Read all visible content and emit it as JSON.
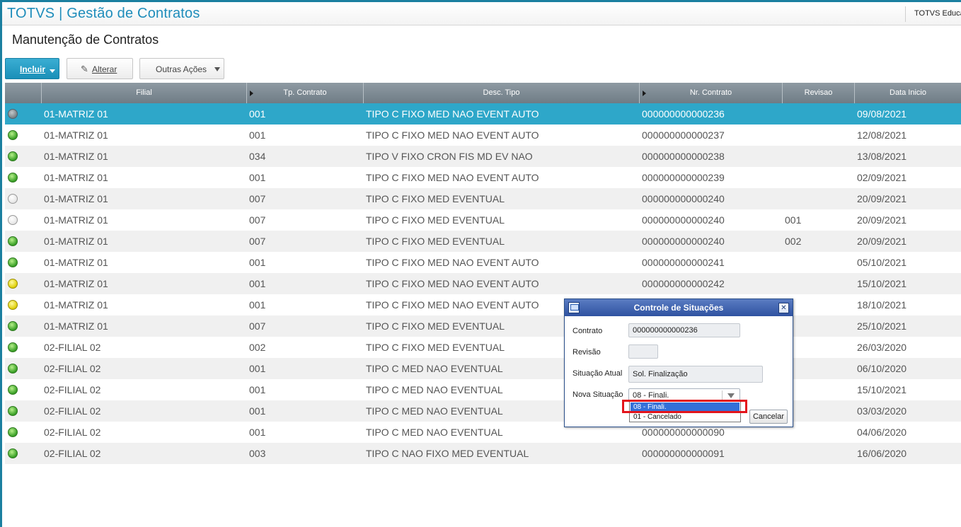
{
  "app": {
    "title": "TOTVS | Gestão de Contratos",
    "header_right": "TOTVS Educacional"
  },
  "page": {
    "title": "Manutenção de Contratos"
  },
  "toolbar": {
    "incluir_label": "Incluir",
    "alterar_label": "Alterar",
    "outras_label": "Outras Ações"
  },
  "grid": {
    "columns": [
      "Filial",
      "Tp. Contrato",
      "Desc. Tipo",
      "Nr. Contrato",
      "Revisao",
      "Data Inicio"
    ],
    "rows": [
      {
        "status": "gray",
        "filial": "01-MATRIZ 01",
        "tp": "001",
        "desc": "TIPO C FIXO MED NAO EVENT AUTO",
        "nr": "000000000000236",
        "rev": "",
        "data": "09/08/2021"
      },
      {
        "status": "green",
        "filial": "01-MATRIZ 01",
        "tp": "001",
        "desc": "TIPO C FIXO MED NAO EVENT AUTO",
        "nr": "000000000000237",
        "rev": "",
        "data": "12/08/2021"
      },
      {
        "status": "green",
        "filial": "01-MATRIZ 01",
        "tp": "034",
        "desc": "TIPO V FIXO CRON FIS MD EV NAO",
        "nr": "000000000000238",
        "rev": "",
        "data": "13/08/2021"
      },
      {
        "status": "green",
        "filial": "01-MATRIZ 01",
        "tp": "001",
        "desc": "TIPO C FIXO MED NAO EVENT AUTO",
        "nr": "000000000000239",
        "rev": "",
        "data": "02/09/2021"
      },
      {
        "status": "white",
        "filial": "01-MATRIZ 01",
        "tp": "007",
        "desc": "TIPO C FIXO MED EVENTUAL",
        "nr": "000000000000240",
        "rev": "",
        "data": "20/09/2021"
      },
      {
        "status": "white",
        "filial": "01-MATRIZ 01",
        "tp": "007",
        "desc": "TIPO C FIXO MED EVENTUAL",
        "nr": "000000000000240",
        "rev": "001",
        "data": "20/09/2021"
      },
      {
        "status": "green",
        "filial": "01-MATRIZ 01",
        "tp": "007",
        "desc": "TIPO C FIXO MED EVENTUAL",
        "nr": "000000000000240",
        "rev": "002",
        "data": "20/09/2021"
      },
      {
        "status": "green",
        "filial": "01-MATRIZ 01",
        "tp": "001",
        "desc": "TIPO C FIXO MED NAO EVENT AUTO",
        "nr": "000000000000241",
        "rev": "",
        "data": "05/10/2021"
      },
      {
        "status": "yellow",
        "filial": "01-MATRIZ 01",
        "tp": "001",
        "desc": "TIPO C FIXO MED NAO EVENT AUTO",
        "nr": "000000000000242",
        "rev": "",
        "data": "15/10/2021"
      },
      {
        "status": "yellow",
        "filial": "01-MATRIZ 01",
        "tp": "001",
        "desc": "TIPO C FIXO MED NAO EVENT AUTO",
        "nr": "",
        "rev": "",
        "data": "18/10/2021"
      },
      {
        "status": "green",
        "filial": "01-MATRIZ 01",
        "tp": "007",
        "desc": "TIPO C FIXO MED EVENTUAL",
        "nr": "",
        "rev": "",
        "data": "25/10/2021"
      },
      {
        "status": "green",
        "filial": "02-FILIAL 02",
        "tp": "002",
        "desc": "TIPO C FIXO MED EVENTUAL",
        "nr": "",
        "rev": "",
        "data": "26/03/2020"
      },
      {
        "status": "green",
        "filial": "02-FILIAL 02",
        "tp": "001",
        "desc": "TIPO C MED NAO EVENTUAL",
        "nr": "",
        "rev": "",
        "data": "06/10/2020"
      },
      {
        "status": "green",
        "filial": "02-FILIAL 02",
        "tp": "001",
        "desc": "TIPO C MED NAO EVENTUAL",
        "nr": "",
        "rev": "",
        "data": "15/10/2021"
      },
      {
        "status": "green",
        "filial": "02-FILIAL 02",
        "tp": "001",
        "desc": "TIPO C MED NAO EVENTUAL",
        "nr": "",
        "rev": "",
        "data": "03/03/2020"
      },
      {
        "status": "green",
        "filial": "02-FILIAL 02",
        "tp": "001",
        "desc": "TIPO C MED NAO EVENTUAL",
        "nr": "000000000000090",
        "rev": "",
        "data": "04/06/2020"
      },
      {
        "status": "green",
        "filial": "02-FILIAL 02",
        "tp": "003",
        "desc": "TIPO C NAO FIXO MED EVENTUAL",
        "nr": "000000000000091",
        "rev": "",
        "data": "16/06/2020"
      }
    ]
  },
  "dialog": {
    "title": "Controle de Situações",
    "contrato_label": "Contrato",
    "contrato_value": "000000000000236",
    "revisao_label": "Revisão",
    "revisao_value": "",
    "situacao_atual_label": "Situação Atual",
    "situacao_atual_value": "Sol. Finalização",
    "nova_situacao_label": "Nova Situação",
    "nova_situacao_value": "08 - Finali.",
    "options": [
      "08 - Finali.",
      "01 - Cancelado"
    ],
    "cancel_label": "Cancelar"
  },
  "colors": {
    "accent": "#1e8dbb",
    "selected_row": "#2ea7c9",
    "header": "#7d8991",
    "highlight": "#e3141b"
  }
}
